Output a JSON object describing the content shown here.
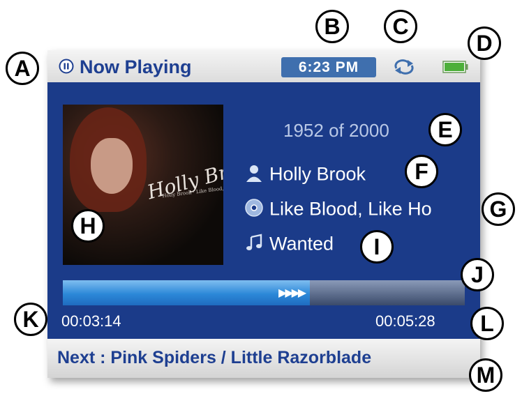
{
  "statusbar": {
    "title": "Now Playing",
    "clock": "6:23 PM",
    "icons": [
      "pause-icon",
      "repeat-icon",
      "battery-icon"
    ]
  },
  "track": {
    "count": "1952 of 2000",
    "artist": "Holly Brook",
    "album": "Like Blood, Like Ho",
    "song": "Wanted",
    "album_art_text": "Holly Brook",
    "album_art_subtext": "Holly Brook · Like Blood, Like Honey"
  },
  "progress": {
    "elapsed": "00:03:14",
    "total": "00:05:28",
    "fraction": 0.615
  },
  "next": "Next : Pink Spiders / Little Razorblade",
  "callouts": {
    "a": "A",
    "b": "B",
    "c": "C",
    "d": "D",
    "e": "E",
    "f": "F",
    "g": "G",
    "h": "H",
    "i": "I",
    "j": "J",
    "k": "K",
    "l": "L",
    "m": "M"
  },
  "colors": {
    "screen_bg": "#1b3b89",
    "title_text": "#1e3f91",
    "clock_bg": "#3f6fae",
    "progress_fill": "#2c88d8"
  }
}
